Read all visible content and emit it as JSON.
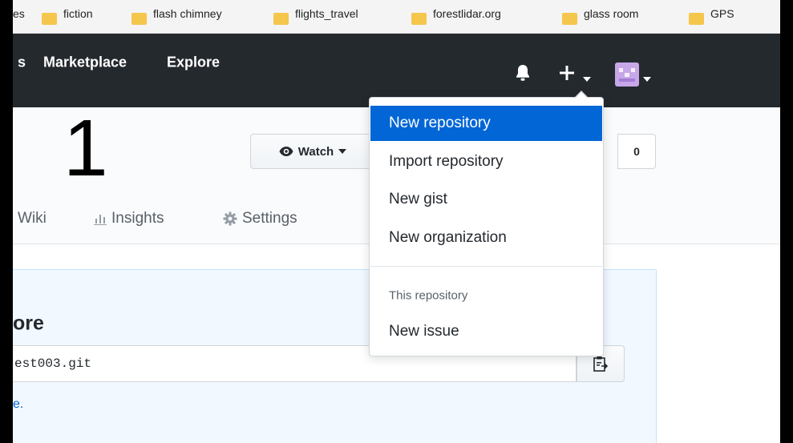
{
  "bookmarks": [
    "es",
    "fiction",
    "flash chimney",
    "flights_travel",
    "forestlidar.org",
    "glass room",
    "GPS"
  ],
  "nav": {
    "partial_link": "s",
    "links": [
      "Marketplace",
      "Explore"
    ]
  },
  "annotation_number": "1",
  "repo": {
    "watch_label": "Watch",
    "counter_value": "0",
    "tabs": [
      "Wiki",
      "Insights",
      "Settings"
    ]
  },
  "quick_setup": {
    "title_fragment": "ore",
    "clone_url_fragment": "est003.git",
    "link_fragment": "e."
  },
  "dropdown": {
    "items": [
      "New repository",
      "Import repository",
      "New gist",
      "New organization"
    ],
    "section_header": "This repository",
    "section_items": [
      "New issue"
    ]
  },
  "colors": {
    "header_bg": "#24292e",
    "accent": "#0366d6",
    "panel_bg": "#f1f8ff",
    "folder": "#f5c64c"
  },
  "icons": {
    "bell": "bell-icon",
    "plus": "plus-icon",
    "avatar": "avatar",
    "eye": "eye-icon",
    "insights": "graph-icon",
    "settings": "gear-icon",
    "clipboard": "clipboard-icon"
  }
}
